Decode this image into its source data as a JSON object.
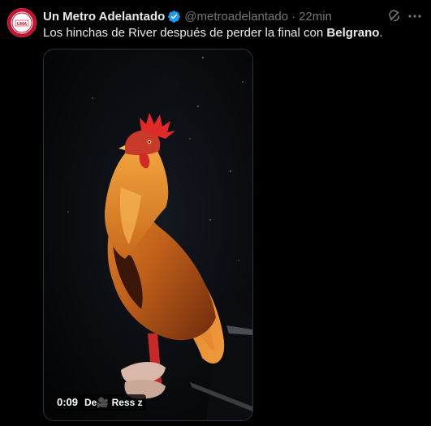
{
  "author": {
    "display_name": "Un Metro Adelantado",
    "handle": "@metroadelantado",
    "separator": "·",
    "time": "22min",
    "avatar_text": "UMA",
    "verified_icon": "verified-badge-icon"
  },
  "tweet": {
    "text_prefix": "Los hinchas de River después de perder la final con ",
    "text_bold": "Belgrano",
    "text_suffix": "."
  },
  "media": {
    "type": "video",
    "subject": "rooster",
    "duration": "0:09",
    "overlay_text": "De🎥 Ress z"
  },
  "actions": {
    "grok_icon": "grok-icon",
    "more_icon": "more-icon"
  },
  "colors": {
    "background": "#000000",
    "text_primary": "#e7e9ea",
    "text_secondary": "#71767b",
    "verified": "#1d9bf0",
    "avatar_red": "#c8102e",
    "border": "#2f3336"
  }
}
